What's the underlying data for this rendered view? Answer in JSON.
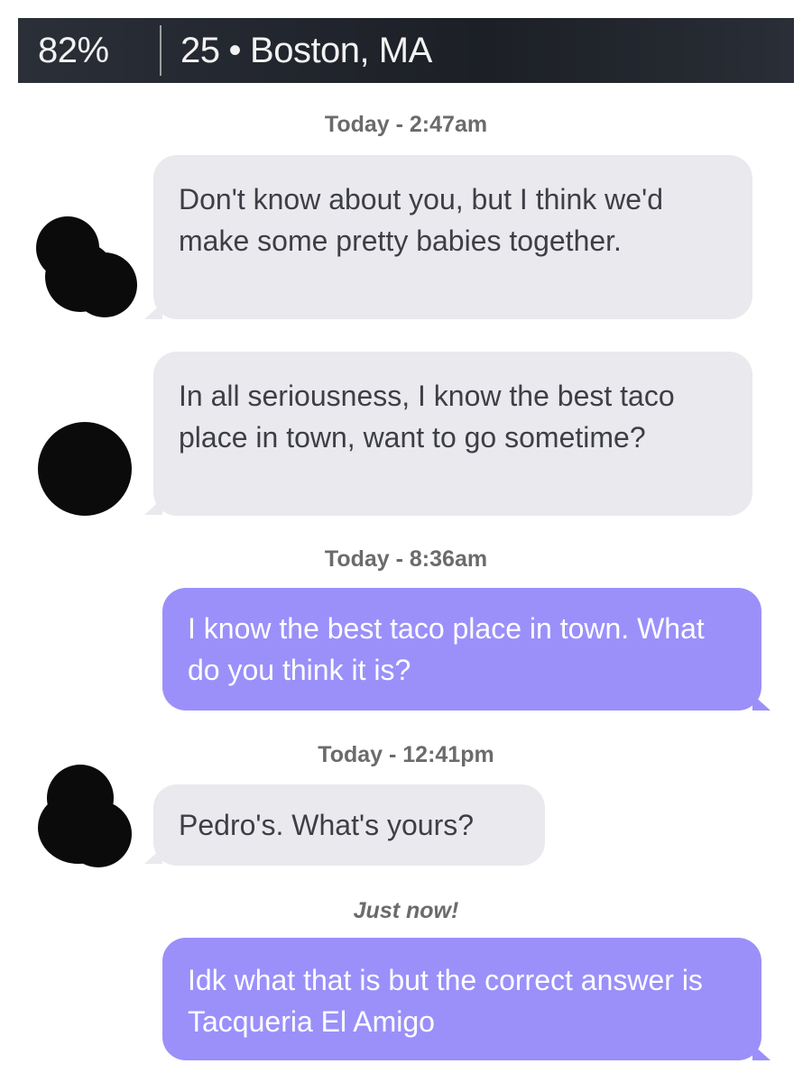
{
  "header": {
    "match_percent": "82%",
    "age": "25",
    "separator": "•",
    "location": "Boston, MA"
  },
  "colors": {
    "incoming_bubble": "#e9e9ee",
    "outgoing_bubble": "#9b90fa",
    "timestamp_text": "#6b6b6b",
    "header_bg": "#1c1f26"
  },
  "conversation": {
    "timestamps": [
      "Today - 2:47am",
      "Today - 8:36am",
      "Today - 12:41pm",
      "Just now!"
    ],
    "messages": [
      {
        "sender": "them",
        "text": "Don't know about you, but I think we'd make some pretty babies together."
      },
      {
        "sender": "them",
        "text": "In all seriousness, I know the best taco place in town, want to go sometime?"
      },
      {
        "sender": "me",
        "text": "I know the best taco place in town. What do you think it is?"
      },
      {
        "sender": "them",
        "text": "Pedro's. What's yours?"
      },
      {
        "sender": "me",
        "text": "Idk what that is but the correct answer is Tacqueria El Amigo"
      }
    ]
  }
}
